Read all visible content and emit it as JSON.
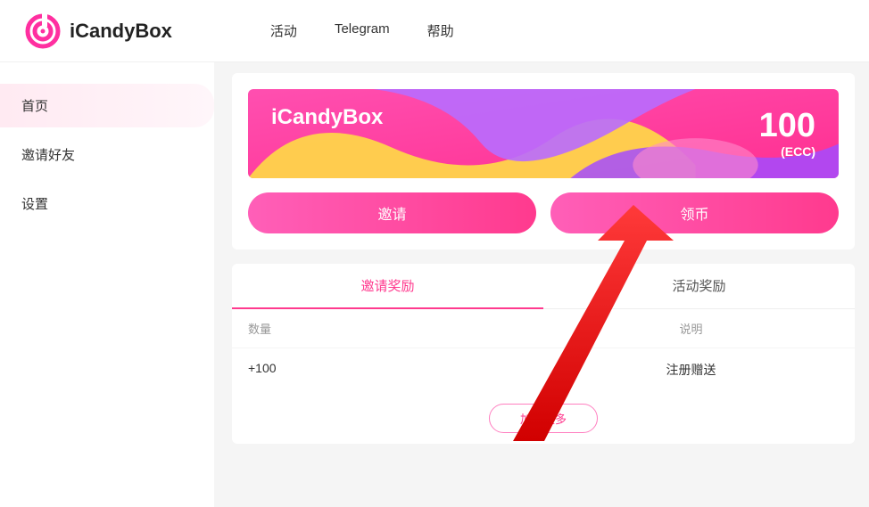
{
  "brand": {
    "name": "iCandyBox"
  },
  "topnav": {
    "items": [
      "活动",
      "Telegram",
      "帮助"
    ]
  },
  "sidebar": {
    "items": [
      "首页",
      "邀请好友",
      "设置"
    ],
    "active_index": 0
  },
  "banner": {
    "title": "iCandyBox",
    "amount": "100",
    "unit": "(ECC)"
  },
  "actions": {
    "invite": "邀请",
    "claim": "领币"
  },
  "rewards": {
    "tabs": [
      "邀请奖励",
      "活动奖励"
    ],
    "active_tab": 0,
    "columns": {
      "qty": "数量",
      "desc": "说明"
    },
    "rows": [
      {
        "qty": "+100",
        "desc": "注册赠送"
      }
    ],
    "load_more": "加载更多"
  },
  "colors": {
    "accent": "#ff3a8e"
  }
}
